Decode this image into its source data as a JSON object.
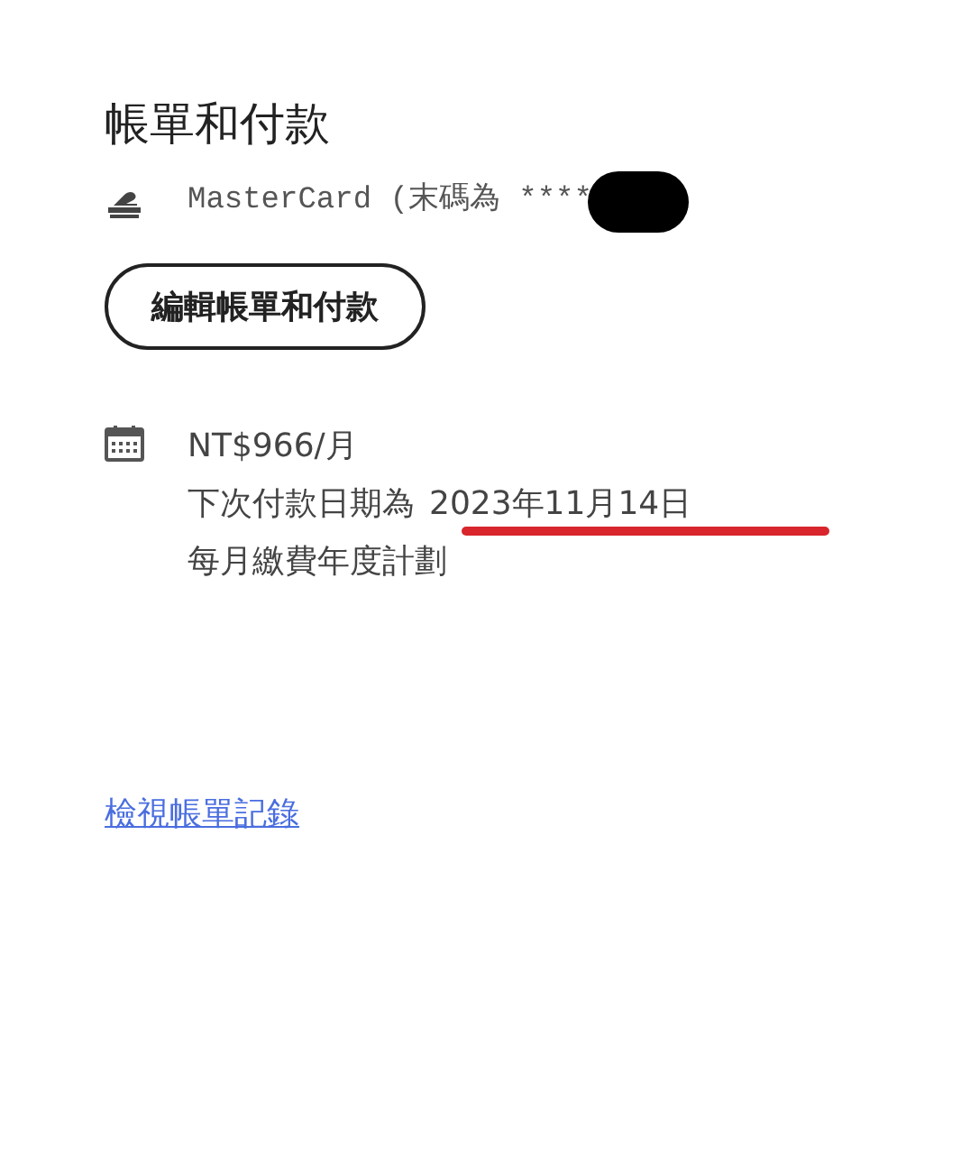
{
  "title": "帳單和付款",
  "card": {
    "text": "MasterCard (末碼為 ****"
  },
  "edit_button": "編輯帳單和付款",
  "plan": {
    "price": "NT$966/月",
    "next_payment_label": "下次付款日期為",
    "next_payment_date": "2023年11月14日",
    "plan_name": "每月繳費年度計劃"
  },
  "history_link": "檢視帳單記錄"
}
